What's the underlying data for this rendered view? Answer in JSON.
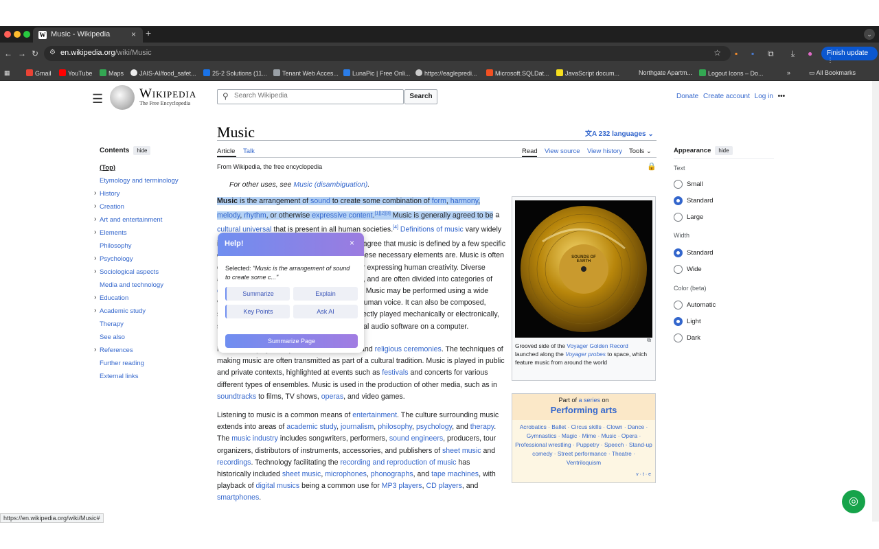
{
  "browser": {
    "tab_title": "Music - Wikipedia",
    "favicon_letter": "W",
    "new_tab": "+",
    "url_host": "en.wikipedia.org",
    "url_path": "/wiki/Music",
    "finish_update": "Finish update",
    "bookmarks": [
      "Gmail",
      "YouTube",
      "Maps",
      "JAIS-AI/food_safet...",
      "25-2 Solutions (11...",
      "Tenant Web Acces...",
      "LunaPic | Free Onli...",
      "https://eaglepredi...",
      "Microsoft.SQLDat...",
      "JavaScript docum...",
      "Northgate Apartm...",
      "Logout Icons – Do..."
    ],
    "all_bookmarks": "All Bookmarks",
    "status_url": "https://en.wikipedia.org/wiki/Music#"
  },
  "header": {
    "wordmark": "Wikipedia",
    "tagline": "The Free Encyclopedia",
    "search_placeholder": "Search Wikipedia",
    "search_button": "Search",
    "donate": "Donate",
    "create_account": "Create account",
    "login": "Log in",
    "more": "•••"
  },
  "toc": {
    "heading": "Contents",
    "hide": "hide",
    "items": [
      {
        "label": "(Top)",
        "expand": false
      },
      {
        "label": "Etymology and terminology",
        "expand": false
      },
      {
        "label": "History",
        "expand": true
      },
      {
        "label": "Creation",
        "expand": true
      },
      {
        "label": "Art and entertainment",
        "expand": true
      },
      {
        "label": "Elements",
        "expand": true
      },
      {
        "label": "Philosophy",
        "expand": false
      },
      {
        "label": "Psychology",
        "expand": true
      },
      {
        "label": "Sociological aspects",
        "expand": true
      },
      {
        "label": "Media and technology",
        "expand": false
      },
      {
        "label": "Education",
        "expand": true
      },
      {
        "label": "Academic study",
        "expand": true
      },
      {
        "label": "Therapy",
        "expand": false
      },
      {
        "label": "See also",
        "expand": false
      },
      {
        "label": "References",
        "expand": true
      },
      {
        "label": "Further reading",
        "expand": false
      },
      {
        "label": "External links",
        "expand": false
      }
    ]
  },
  "article": {
    "title": "Music",
    "languages": "232 languages",
    "tab_article": "Article",
    "tab_talk": "Talk",
    "read": "Read",
    "view_source": "View source",
    "view_history": "View history",
    "tools": "Tools",
    "from_wp": "From Wikipedia, the free encyclopedia",
    "hatnote_prefix": "For other uses, see ",
    "hatnote_link": "Music (disambiguation)",
    "hatnote_suffix": "."
  },
  "popup": {
    "title": "Help!",
    "close": "×",
    "selected_label": "Selected:",
    "selected_text": "\"Music is the arrangement of sound to create some c...\"",
    "summarize": "Summarize",
    "explain": "Explain",
    "key_points": "Key Points",
    "ask_ai": "Ask AI",
    "summarize_page": "Summarize Page"
  },
  "infobox": {
    "caption_1": "Grooved side of the ",
    "caption_link1": "Voyager Golden Record",
    "caption_2": " launched along the ",
    "caption_link2": "Voyager probes",
    "caption_3": " to space, which feature music from around the world",
    "record_label": "SOUNDS OF EARTH"
  },
  "series": {
    "part_of": "Part of ",
    "a_series": "a series",
    "on": " on",
    "title": "Performing arts",
    "items": "Acrobatics · Ballet · Circus skills · Clown · Dance · Gymnastics · Magic · Mime · Music · Opera · Professional wrestling · Puppetry · Speech · Stand-up comedy · Street performance · Theatre · Ventriloquism",
    "vte": "v · t · e"
  },
  "appearance": {
    "heading": "Appearance",
    "hide": "hide",
    "text_label": "Text",
    "text_options": [
      "Small",
      "Standard",
      "Large"
    ],
    "text_selected": "Standard",
    "width_label": "Width",
    "width_options": [
      "Standard",
      "Wide"
    ],
    "width_selected": "Standard",
    "color_label": "Color (beta)",
    "color_options": [
      "Automatic",
      "Light",
      "Dark"
    ],
    "color_selected": "Light"
  },
  "colors": {
    "link": "#3366cc",
    "highlight": "#b5d2f5",
    "popup_gradient_start": "#6f8ef0",
    "popup_gradient_end": "#a17ce2",
    "fab": "#16a34a"
  }
}
